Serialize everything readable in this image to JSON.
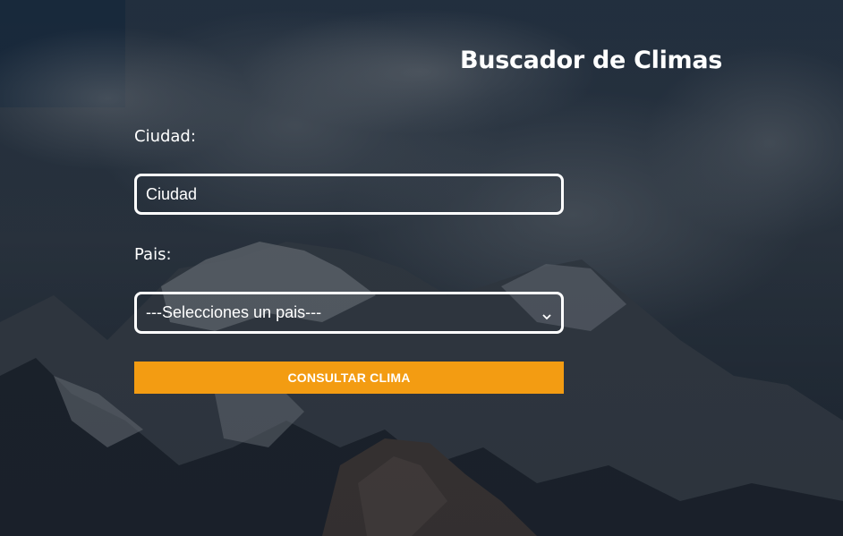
{
  "page": {
    "title": "Buscador de Climas"
  },
  "form": {
    "city_label": "Ciudad:",
    "city_placeholder": "Ciudad",
    "city_value": "",
    "country_label": "Pais:",
    "country_selected": "---Selecciones un pais---",
    "submit_label": "CONSULTAR CLIMA"
  },
  "colors": {
    "accent": "#f39c12",
    "text": "#ffffff",
    "overlay": "#1e2a36"
  },
  "icons": {
    "select_arrow": "chevron-down-icon"
  }
}
